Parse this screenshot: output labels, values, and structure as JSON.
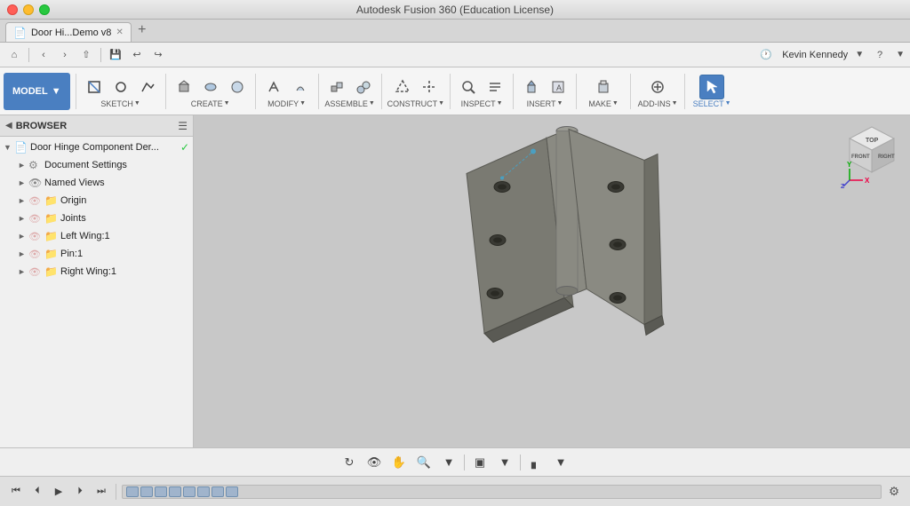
{
  "window": {
    "title": "Autodesk Fusion 360 (Education License)"
  },
  "tab": {
    "label": "Door Hi...Demo v8",
    "icon": "📄",
    "close": "✕"
  },
  "navbar": {
    "back": "‹",
    "forward": "›",
    "up": "↑",
    "clock_icon": "🕐",
    "user": "Kevin Kennedy",
    "help": "?"
  },
  "toolbar": {
    "model_label": "MODEL",
    "sketch_label": "SKETCH",
    "create_label": "CREATE",
    "modify_label": "MODIFY",
    "assemble_label": "ASSEMBLE",
    "construct_label": "CONSTRUCT",
    "inspect_label": "INSPECT",
    "insert_label": "INSERT",
    "make_label": "MAKE",
    "addins_label": "ADD-INS",
    "select_label": "SELECT"
  },
  "browser": {
    "title": "BROWSER",
    "items": [
      {
        "label": "Door Hinge Component Der...",
        "level": 0,
        "has_arrow": true,
        "has_check": true,
        "icon": "📄"
      },
      {
        "label": "Document Settings",
        "level": 1,
        "has_arrow": true,
        "icon": "⚙"
      },
      {
        "label": "Named Views",
        "level": 1,
        "has_arrow": true,
        "icon": "📋"
      },
      {
        "label": "Origin",
        "level": 1,
        "has_arrow": true,
        "icon": "📁"
      },
      {
        "label": "Joints",
        "level": 1,
        "has_arrow": true,
        "icon": "📁"
      },
      {
        "label": "Left Wing:1",
        "level": 1,
        "has_arrow": true,
        "icon": "📁"
      },
      {
        "label": "Pin:1",
        "level": 1,
        "has_arrow": true,
        "icon": "📁"
      },
      {
        "label": "Right Wing:1",
        "level": 1,
        "has_arrow": true,
        "icon": "📁"
      }
    ]
  },
  "viewcube": {
    "front": "FRONT",
    "top": "TOP",
    "right": "RIGHT",
    "axis_x": "X",
    "axis_y": "Y"
  },
  "timeline": {
    "play": "▶",
    "steps": 8
  },
  "colors": {
    "accent": "#4a7fc1",
    "hinge": "#7a7a72",
    "hinge_dark": "#5a5a54",
    "hinge_hole": "#3a3a34",
    "bg_viewport": "#c8c8c8"
  }
}
